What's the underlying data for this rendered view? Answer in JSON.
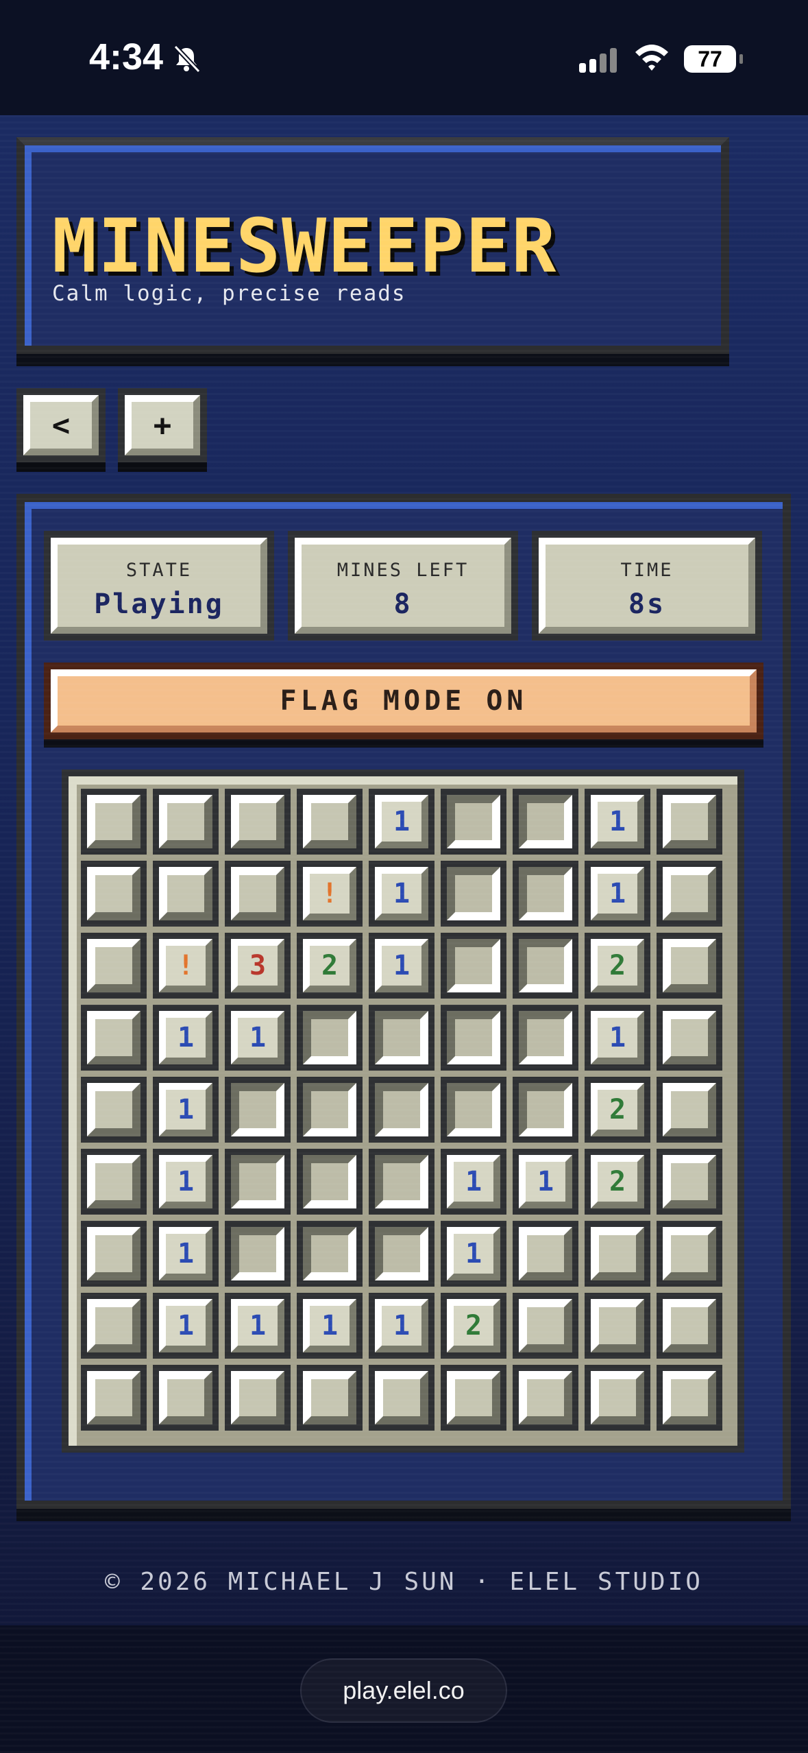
{
  "status_bar": {
    "time": "4:34",
    "battery": "77",
    "icons": [
      "bell-slash-icon",
      "cellular-signal-icon",
      "wifi-icon",
      "battery-icon"
    ]
  },
  "header": {
    "title": "MINESWEEPER",
    "subtitle": "Calm logic, precise reads"
  },
  "toolbar": {
    "back_label": "<",
    "new_label": "+"
  },
  "stats": {
    "state": {
      "label": "STATE",
      "value": "Playing"
    },
    "mines_left": {
      "label": "MINES LEFT",
      "value": "8"
    },
    "time": {
      "label": "TIME",
      "value": "8s"
    }
  },
  "flag_mode": {
    "label": "FLAG MODE ON"
  },
  "board": {
    "rows": 9,
    "cols": 9,
    "legend": {
      "H": "hidden",
      "O": "revealed-empty",
      "F": "flagged",
      "1": "number",
      "2": "number",
      "3": "number"
    },
    "grid": [
      [
        "H",
        "H",
        "H",
        "H",
        "1",
        "O",
        "O",
        "1",
        "H"
      ],
      [
        "H",
        "H",
        "H",
        "F",
        "1",
        "O",
        "O",
        "1",
        "H"
      ],
      [
        "H",
        "F",
        "3",
        "2",
        "1",
        "O",
        "O",
        "2",
        "H"
      ],
      [
        "H",
        "1",
        "1",
        "O",
        "O",
        "O",
        "O",
        "1",
        "H"
      ],
      [
        "H",
        "1",
        "O",
        "O",
        "O",
        "O",
        "O",
        "2",
        "H"
      ],
      [
        "H",
        "1",
        "O",
        "O",
        "O",
        "1",
        "1",
        "2",
        "H"
      ],
      [
        "H",
        "1",
        "O",
        "O",
        "O",
        "1",
        "H",
        "H",
        "H"
      ],
      [
        "H",
        "1",
        "1",
        "1",
        "1",
        "2",
        "H",
        "H",
        "H"
      ],
      [
        "H",
        "H",
        "H",
        "H",
        "H",
        "H",
        "H",
        "H",
        "H"
      ]
    ],
    "flag_symbol": "!",
    "colors": {
      "1": "#2b4bb3",
      "2": "#2f7a37",
      "3": "#b8362b",
      "flag": "#e2742c"
    }
  },
  "footer": {
    "text": "© 2026 MICHAEL J SUN · ELEL STUDIO"
  },
  "browser": {
    "url": "play.elel.co"
  },
  "theme": {
    "accent": "#ffd56a",
    "panel": "#1f2d63",
    "border": "#3b62c9"
  }
}
